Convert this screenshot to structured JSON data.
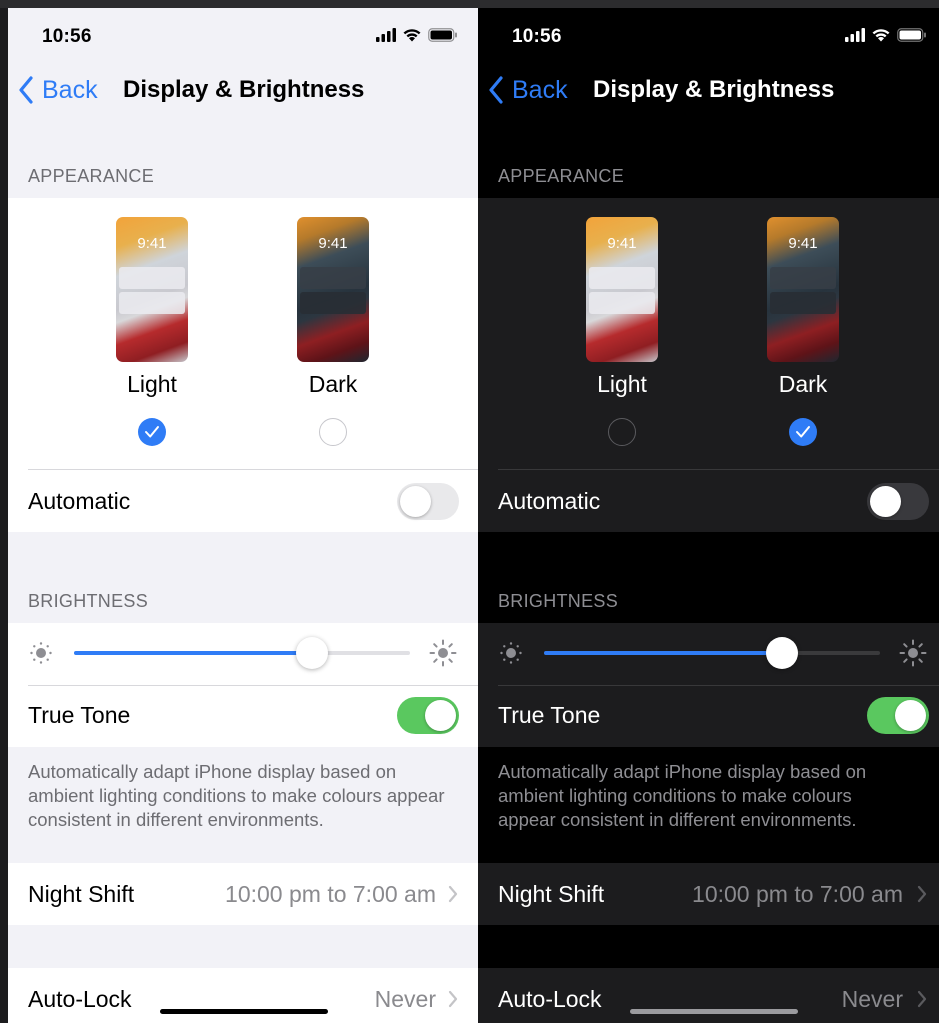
{
  "light": {
    "status": {
      "time": "10:56"
    },
    "nav": {
      "back_label": "Back",
      "title": "Display & Brightness"
    },
    "appearance": {
      "header": "APPEARANCE",
      "options": [
        {
          "label": "Light",
          "preview_time": "9:41",
          "selected": true
        },
        {
          "label": "Dark",
          "preview_time": "9:41",
          "selected": false
        }
      ],
      "automatic_label": "Automatic",
      "automatic_on": false
    },
    "brightness": {
      "header": "BRIGHTNESS",
      "level": 0.7,
      "true_tone_label": "True Tone",
      "true_tone_on": true,
      "true_tone_footer": "Automatically adapt iPhone display based on ambient lighting conditions to make colours appear consistent in different environments."
    },
    "night_shift": {
      "label": "Night Shift",
      "value": "10:00 pm to 7:00 am"
    },
    "auto_lock": {
      "label": "Auto-Lock",
      "value": "Never"
    }
  },
  "dark": {
    "status": {
      "time": "10:56"
    },
    "nav": {
      "back_label": "Back",
      "title": "Display & Brightness"
    },
    "appearance": {
      "header": "APPEARANCE",
      "options": [
        {
          "label": "Light",
          "preview_time": "9:41",
          "selected": false
        },
        {
          "label": "Dark",
          "preview_time": "9:41",
          "selected": true
        }
      ],
      "automatic_label": "Automatic",
      "automatic_on": false
    },
    "brightness": {
      "header": "BRIGHTNESS",
      "level": 0.7,
      "true_tone_label": "True Tone",
      "true_tone_on": true,
      "true_tone_footer": "Automatically adapt iPhone display based on ambient lighting conditions to make colours appear consistent in different environments."
    },
    "night_shift": {
      "label": "Night Shift",
      "value": "10:00 pm to 7:00 am"
    },
    "auto_lock": {
      "label": "Auto-Lock",
      "value": "Never"
    }
  },
  "colors": {
    "accent": "#2f7cf6",
    "toggle_on": "#5ac85f"
  },
  "icons": [
    "chevron-left-icon",
    "chevron-right-icon",
    "cellular-signal-icon",
    "wifi-icon",
    "battery-icon",
    "sun-low-icon",
    "sun-high-icon",
    "checkmark-icon"
  ]
}
